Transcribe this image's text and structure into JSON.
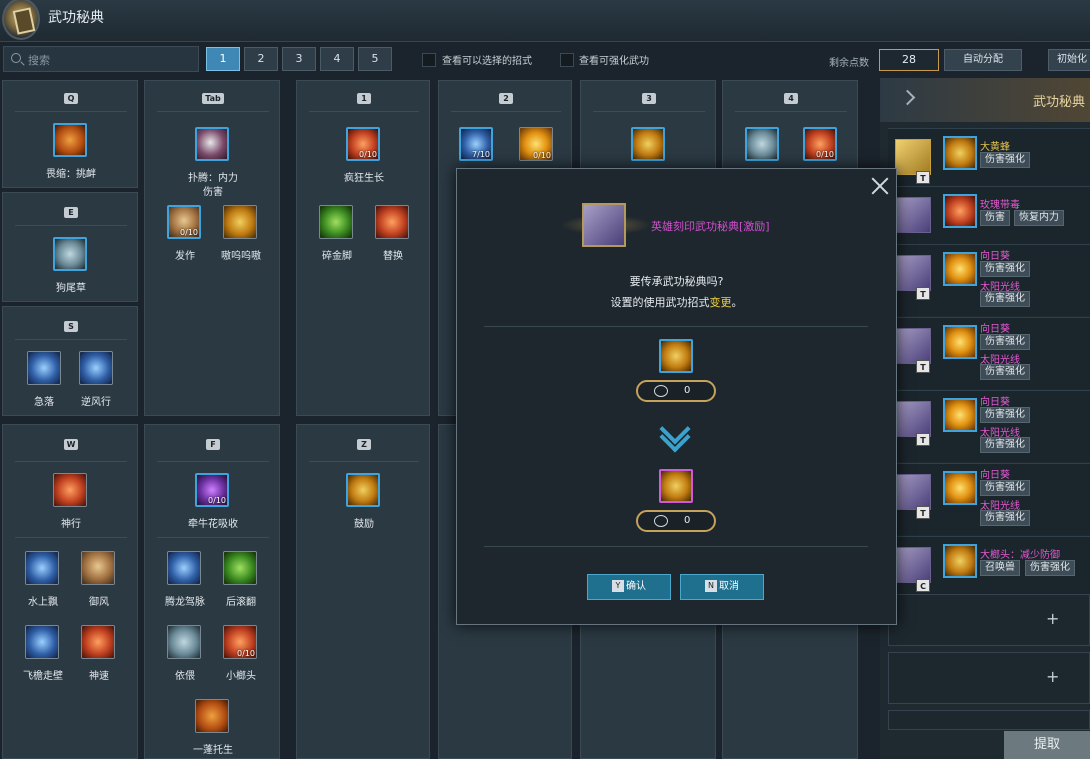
{
  "window": {
    "title": "武功秘典"
  },
  "toolbar": {
    "search_placeholder": "搜索",
    "pages": [
      "1",
      "2",
      "3",
      "4",
      "5"
    ],
    "filter1": "查看可以选择的招式",
    "filter2": "查看可强化武功",
    "points_label": "剩余点数",
    "points_value": "28",
    "auto_button": "自动分配",
    "reset_button": "初始化"
  },
  "keys": {
    "q": "Q",
    "tab": "Tab",
    "k1": "1",
    "k2": "2",
    "k3": "3",
    "k4": "4",
    "e": "E",
    "s": "S",
    "w": "W",
    "f": "F",
    "z": "Z"
  },
  "skills": {
    "q1": "畏缩：挑衅",
    "tab1": "扑腾：内力",
    "tab1b": "伤害",
    "tab2": "发作",
    "tab3": "嗷呜呜嗷",
    "k1a": "疯狂生长",
    "k1b": "碎金脚",
    "k1c": "替换",
    "e1": "狗尾草",
    "s1": "急落",
    "s2": "逆风行",
    "w1": "神行",
    "w2": "水上飘",
    "w3": "御风",
    "w4": "飞檐走壁",
    "w5": "神速",
    "f1": "牵牛花吸收",
    "f2": "腾龙驾脉",
    "f3": "后滚翻",
    "f4": "依偎",
    "f5": "小榔头",
    "f6": "一蓬托生",
    "z1": "鼓励",
    "lv_010": "0/10",
    "lv_710": "7/10"
  },
  "right_panel": {
    "title": "武功秘典",
    "items": [
      {
        "tag": "T",
        "name": "大黄蜂",
        "chips": [
          "伤害强化"
        ]
      },
      {
        "tag": "",
        "name": "玫瑰带毒",
        "chips": [
          "伤害",
          "恢复内力"
        ]
      },
      {
        "tag": "T",
        "name": "向日葵",
        "chips": [
          "伤害强化",
          "太阳光线",
          "伤害强化"
        ]
      },
      {
        "tag": "T",
        "name": "向日葵",
        "chips": [
          "伤害强化",
          "太阳光线",
          "伤害强化"
        ]
      },
      {
        "tag": "T",
        "name": "向日葵",
        "chips": [
          "伤害强化",
          "太阳光线",
          "伤害强化"
        ]
      },
      {
        "tag": "T",
        "name": "向日葵",
        "chips": [
          "伤害强化",
          "太阳光线",
          "伤害强化"
        ]
      },
      {
        "tag": "C",
        "name": "大榔头：减少防御",
        "chips": [
          "召唤兽",
          "伤害强化"
        ]
      }
    ],
    "plus": "+",
    "extract": "提取"
  },
  "modal": {
    "book_name": "英雄刻印武功秘典[激励]",
    "question": "要传承武功秘典吗?",
    "note_prefix": "设置的使用武功招式",
    "note_highlight": "变更",
    "note_suffix": "。",
    "gauge_top": "0",
    "gauge_bottom": "0",
    "confirm_key": "Y",
    "confirm": "确认",
    "cancel_key": "N",
    "cancel": "取消"
  },
  "colors": {
    "accent": "#3fa4de",
    "gold": "#c6a35a",
    "pink": "#d34fcf",
    "yellow": "#e6c348"
  }
}
